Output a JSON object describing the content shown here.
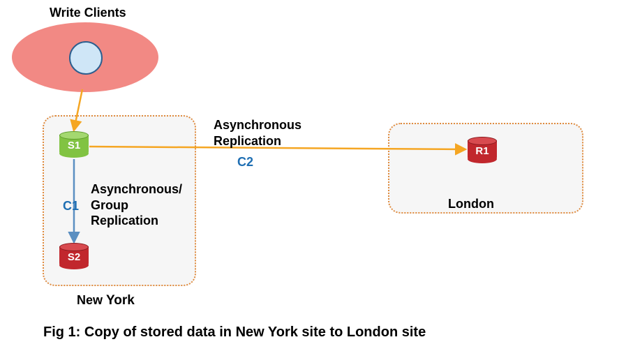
{
  "title": "Write Clients",
  "nodes": {
    "s1": "S1",
    "s2": "S2",
    "r1": "R1"
  },
  "channels": {
    "c1": "C1",
    "c2": "C2"
  },
  "labels": {
    "async_replication": "Asynchronous\nReplication",
    "async_group_replication": "Asynchronous/\nGroup\nReplication",
    "ny": "New",
    "york": "York",
    "london": "London"
  },
  "caption": "Fig 1: Copy of stored data in New York site to London site",
  "chart_data": {
    "type": "diagram",
    "title": "Copy of stored data in New York site to London site",
    "nodes": [
      {
        "id": "clients",
        "label": "Write Clients",
        "type": "client-cloud"
      },
      {
        "id": "S1",
        "label": "S1",
        "site": "New York",
        "type": "server",
        "color": "green"
      },
      {
        "id": "S2",
        "label": "S2",
        "site": "New York",
        "type": "server",
        "color": "red"
      },
      {
        "id": "R1",
        "label": "R1",
        "site": "London",
        "type": "server",
        "color": "red"
      }
    ],
    "edges": [
      {
        "from": "clients",
        "to": "S1",
        "label": "",
        "color": "orange"
      },
      {
        "from": "S1",
        "to": "S2",
        "label": "Asynchronous/Group Replication",
        "channel": "C1",
        "color": "blue"
      },
      {
        "from": "S1",
        "to": "R1",
        "label": "Asynchronous Replication",
        "channel": "C2",
        "color": "orange"
      }
    ],
    "sites": [
      {
        "name": "New York",
        "members": [
          "S1",
          "S2"
        ]
      },
      {
        "name": "London",
        "members": [
          "R1"
        ]
      }
    ]
  }
}
